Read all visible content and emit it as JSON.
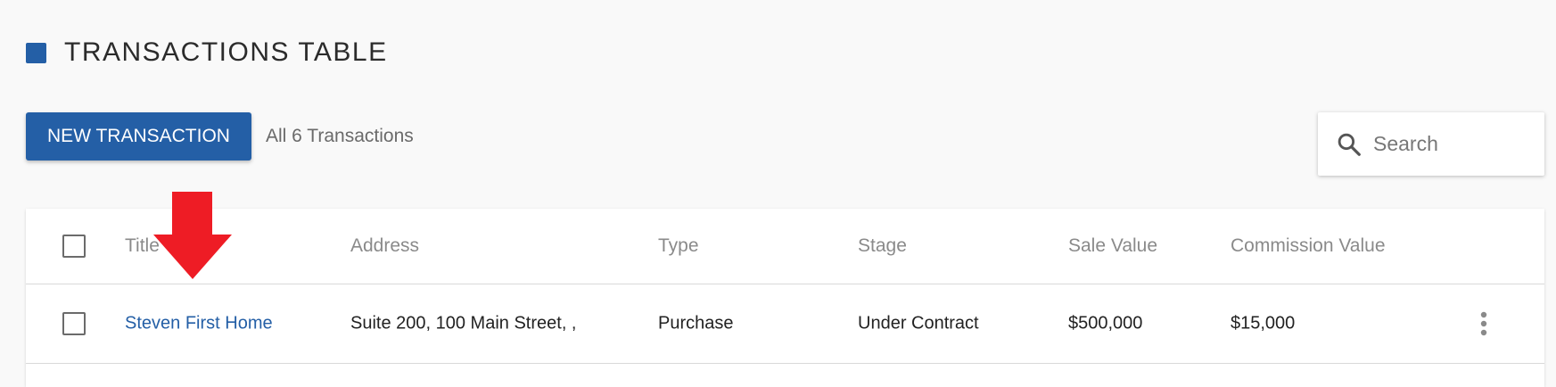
{
  "header": {
    "title": "TRANSACTIONS TABLE",
    "accent_color": "#245fa6"
  },
  "toolbar": {
    "new_button_label": "NEW TRANSACTION",
    "count_text": "All 6 Transactions"
  },
  "search": {
    "placeholder": "Search",
    "icon": "search-icon"
  },
  "table": {
    "columns": [
      "Title",
      "Address",
      "Type",
      "Stage",
      "Sale Value",
      "Commission Value"
    ],
    "rows": [
      {
        "title": "Steven First Home",
        "address": "Suite 200, 100 Main Street, ,",
        "type": "Purchase",
        "stage": "Under Contract",
        "sale_value": "$500,000",
        "commission_value": "$15,000"
      }
    ]
  },
  "annotation": {
    "arrow_color": "#ee1c25"
  }
}
